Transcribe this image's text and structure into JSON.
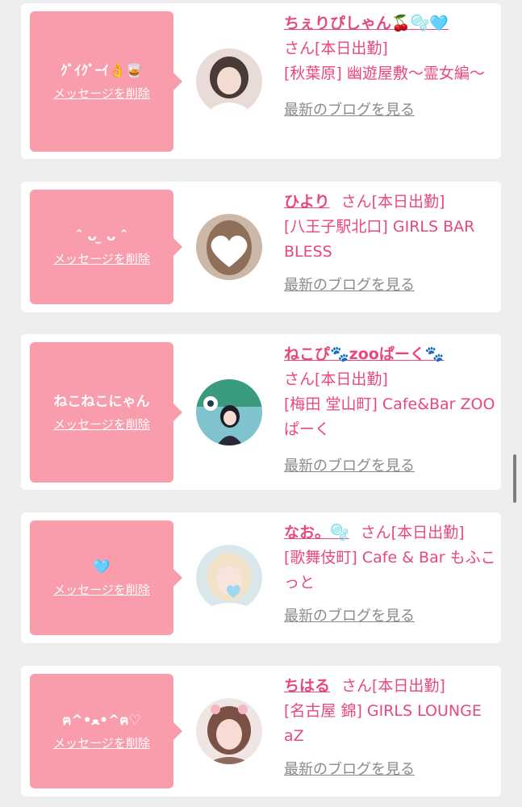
{
  "items": [
    {
      "message": "ｸﾞｲｸﾞｰｲ👌🥃",
      "delete_label": "メッセージを削除",
      "name": "ちぇりぴしゃん🍒🫧🩵",
      "suffix": "さん[本日出勤]",
      "store": "[秋葉原] 幽遊屋敷〜霊女編〜",
      "blog_label": "最新のブログを見る"
    },
    {
      "message": "ˆ ᴗ ̫ ᴗ ˆ",
      "delete_label": "メッセージを削除",
      "name": "ひより",
      "suffix": "さん[本日出勤]",
      "store": "[八王子駅北口] GIRLS BAR BLESS",
      "blog_label": "最新のブログを見る"
    },
    {
      "message": "ねこねこにゃん",
      "delete_label": "メッセージを削除",
      "name": "ねこぴ🐾zooぱーく🐾",
      "suffix": "さん[本日出勤]",
      "store": "[梅田 堂山町] Cafe&Bar ZOOぱーく",
      "blog_label": "最新のブログを見る"
    },
    {
      "message": "🩵",
      "delete_label": "メッセージを削除",
      "name": "なお。🫧",
      "suffix": "さん[本日出勤]",
      "store": "[歌舞伎町] Cafe & Bar もふこっと",
      "blog_label": "最新のブログを見る"
    },
    {
      "message": "ฅ^•ﻌ•^ฅ♡",
      "delete_label": "メッセージを削除",
      "name": "ちはる",
      "suffix": "さん[本日出勤]",
      "store": "[名古屋 錦] GIRLS LOUNGE aZ",
      "blog_label": "最新のブログを見る"
    }
  ],
  "colors": {
    "accent": "#e8487a",
    "bubble": "#f99cac",
    "link_gray": "#8a8a8a",
    "background": "#eeeeee"
  }
}
